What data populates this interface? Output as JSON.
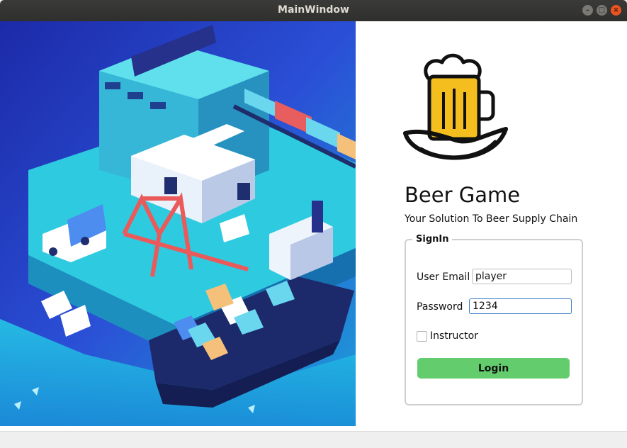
{
  "window": {
    "title": "MainWindow"
  },
  "app": {
    "title": "Beer Game",
    "subtitle": "Your Solution To Beer Supply Chain"
  },
  "signin": {
    "legend": "SignIn",
    "email_label": "User Email",
    "email_value": "player",
    "password_label": "Password",
    "password_value": "1234",
    "instructor_label": "Instructor",
    "instructor_checked": false,
    "login_label": "Login"
  },
  "colors": {
    "login_button": "#63cd6d",
    "titlebar": "#2f2f2d",
    "close_button": "#e95420"
  },
  "icons": [
    "beer-mug-logo-icon",
    "close-icon",
    "maximize-icon",
    "minimize-icon"
  ]
}
